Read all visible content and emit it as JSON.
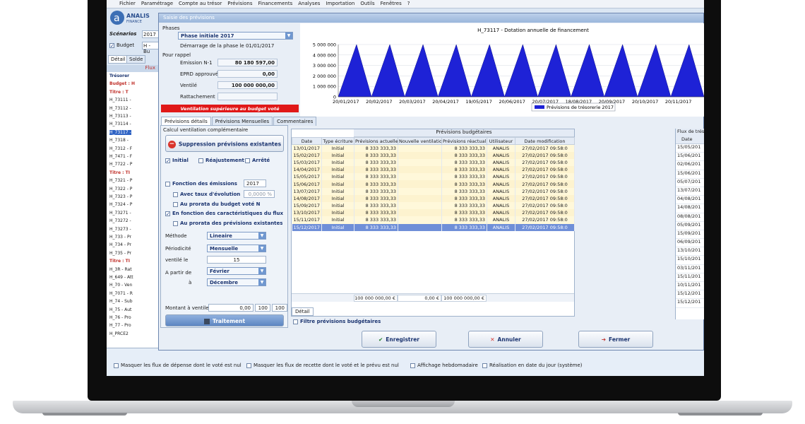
{
  "menu": [
    "Fichier",
    "Paramétrage",
    "Compte au trésor",
    "Prévisions",
    "Financements",
    "Analyses",
    "Importation",
    "Outils",
    "Fenêtres",
    "?"
  ],
  "logo": {
    "brand": "ANALIS",
    "sub": "FINANCE"
  },
  "left_panel": {
    "scenarios_label": "Scénarios",
    "scenario_value": "2017",
    "budget_label": "Budget",
    "budget_value": "H - Bu",
    "tabs": [
      "Détail",
      "Solde"
    ],
    "header": "Flux",
    "tree": [
      "Trésorer",
      "Budget : H",
      "Titre : T",
      "H_73111 -",
      "H_73112 -",
      "H_73113 -",
      "H_73114 -",
      "H_73117 -",
      "H_7318 -",
      "H_7312 - F",
      "H_7471 - F",
      "H_7722 - P",
      "Titre : TI",
      "H_7321 - P",
      "H_7322 - P",
      "H_7323 - P",
      "H_7324 - P",
      "H_73271 -",
      "H_73272 -",
      "H_73273 -",
      "H_733 - Pr",
      "H_734 - Pr",
      "H_735 - Pr",
      "Titre : TI",
      "H_3R - Rat",
      "H_649 - Att",
      "H_70 - Ven",
      "H_7071 - R",
      "H_74 - Sub",
      "H_75 - Aut",
      "H_76 - Pro",
      "H_77 - Pro",
      "H_PRCE2"
    ]
  },
  "dialog": {
    "title": "Saisie des prévisions",
    "phases_label": "Phases",
    "phase_value": "Phase initiale 2017",
    "phase_start": "Démarrage de la phase le 01/01/2017",
    "rappel_label": "Pour rappel",
    "emission_label": "Emission N-1",
    "emission_value": "80 180 597,00",
    "eprd_label": "EPRD approuvé",
    "eprd_value": "0,00",
    "ventile_label": "Ventilé",
    "ventile_value": "100 000 000,00",
    "rattachement_label": "Rattachement",
    "warning": "Ventilation supérieure au budget voté",
    "tabs": [
      "Prévisions détails",
      "Prévisions Mensuelles",
      "Commentaires"
    ],
    "calc_label": "Calcul ventilation complémentaire",
    "suppression_button": "Suppression prévisions existantes",
    "check_initial": "Initial",
    "check_reajustement": "Réajustement",
    "check_arrete": "Arrêté",
    "fonction_emissions": "Fonction des émissions",
    "fonction_year": "2017",
    "taux_label": "Avec taux d'évolution",
    "taux_value": "0,0000 %",
    "prorata_vote": "Au prorata du budget voté N",
    "caract_flux": "En fonction des caractéristiques du flux",
    "prorata_prev": "Au prorata des prévisions existantes",
    "methode_label": "Méthode",
    "methode_value": "Lineaire",
    "periodicite_label": "Périodicité",
    "periodicite_value": "Mensuelle",
    "ventile_le_label": "ventilé le",
    "ventile_le_value": "15",
    "partir_label": "A partir de",
    "partir_value": "Février",
    "a_label": "à",
    "a_value": "Décembre",
    "montant_label": "Montant à ventiler",
    "montant_value": "0,00",
    "montant_pct1": "100",
    "montant_pct2": "100",
    "traitement_button": "Traitement",
    "filtre_label": "Filtre prévisions budgétaires",
    "detail_tab": "Détail",
    "save_button": "Enregistrer",
    "cancel_button": "Annuler",
    "close_button": "Fermer"
  },
  "grid": {
    "group_header": "Prévisions budgétaires",
    "columns": [
      "Date",
      "Type écriture",
      "Prévisions actuelles",
      "Nouvelle ventilation",
      "Prévisions réactual.",
      "Utilisateur",
      "Date modification"
    ],
    "rows": [
      [
        "13/01/2017",
        "Initial",
        "8 333 333,33",
        "",
        "8 333 333,33",
        "ANALIS",
        "27/02/2017 09:58:0"
      ],
      [
        "15/02/2017",
        "Initial",
        "8 333 333,33",
        "",
        "8 333 333,33",
        "ANALIS",
        "27/02/2017 09:58:0"
      ],
      [
        "15/03/2017",
        "Initial",
        "8 333 333,33",
        "",
        "8 333 333,33",
        "ANALIS",
        "27/02/2017 09:58:0"
      ],
      [
        "14/04/2017",
        "Initial",
        "8 333 333,33",
        "",
        "8 333 333,33",
        "ANALIS",
        "27/02/2017 09:58:0"
      ],
      [
        "15/05/2017",
        "Initial",
        "8 333 333,33",
        "",
        "8 333 333,33",
        "ANALIS",
        "27/02/2017 09:58:0"
      ],
      [
        "15/06/2017",
        "Initial",
        "8 333 333,33",
        "",
        "8 333 333,33",
        "ANALIS",
        "27/02/2017 09:58:0"
      ],
      [
        "13/07/2017",
        "Initial",
        "8 333 333,33",
        "",
        "8 333 333,33",
        "ANALIS",
        "27/02/2017 09:58:0"
      ],
      [
        "14/08/2017",
        "Initial",
        "8 333 333,33",
        "",
        "8 333 333,33",
        "ANALIS",
        "27/02/2017 09:58:0"
      ],
      [
        "15/09/2017",
        "Initial",
        "8 333 333,33",
        "",
        "8 333 333,33",
        "ANALIS",
        "27/02/2017 09:58:0"
      ],
      [
        "13/10/2017",
        "Initial",
        "8 333 333,33",
        "",
        "8 333 333,33",
        "ANALIS",
        "27/02/2017 09:58:0"
      ],
      [
        "15/11/2017",
        "Initial",
        "8 333 333,33",
        "",
        "8 333 333,33",
        "ANALIS",
        "27/02/2017 09:58:0"
      ],
      [
        "15/12/2017",
        "Initial",
        "8 333 333,33",
        "",
        "8 333 333,33",
        "ANALIS",
        "27/02/2017 09:58:0"
      ]
    ],
    "totals": [
      "100 000 000,00 €",
      "0,00 €",
      "100 000 000,00 €"
    ]
  },
  "right_grid": {
    "header": "Flux de trés",
    "col": "Date",
    "dates": [
      "15/05/201",
      "15/06/201",
      "02/06/201",
      "15/06/201",
      "05/07/201",
      "13/07/201",
      "04/08/201",
      "14/08/201",
      "08/08/201",
      "05/09/201",
      "15/09/201",
      "06/09/201",
      "13/10/201",
      "15/10/201",
      "03/11/201",
      "15/11/201",
      "10/11/201",
      "15/12/201",
      "15/12/201"
    ]
  },
  "bottom_bar": {
    "opt1": "Masquer les flux de dépense dont le voté est nul",
    "opt2": "Masquer les flux de recette dont le voté et le prévu est nul",
    "opt3": "Affichage hebdomadaire",
    "opt4": "Réalisation en date du jour (système)"
  },
  "chart_data": {
    "type": "area",
    "title": "H_73117 - Dotation annuelle de financement",
    "legend": "Prévisions de trésorerie 2017",
    "legend_position": "bottom-center",
    "color": "#1e22d6",
    "ylim": [
      0,
      5000000
    ],
    "yticks": [
      "5 000 000",
      "4 000 000",
      "3 000 000",
      "2 000 000",
      "1 000 000",
      "0"
    ],
    "xticks": [
      "20/01/2017",
      "20/02/2017",
      "20/03/2017",
      "20/04/2017",
      "19/05/2017",
      "20/06/2017",
      "20/07/2017",
      "18/08/2017",
      "20/09/2017",
      "20/10/2017",
      "20/11/2017"
    ],
    "series": [
      {
        "peaks": 5000000,
        "troughs": 0,
        "cycles": 11
      }
    ]
  }
}
